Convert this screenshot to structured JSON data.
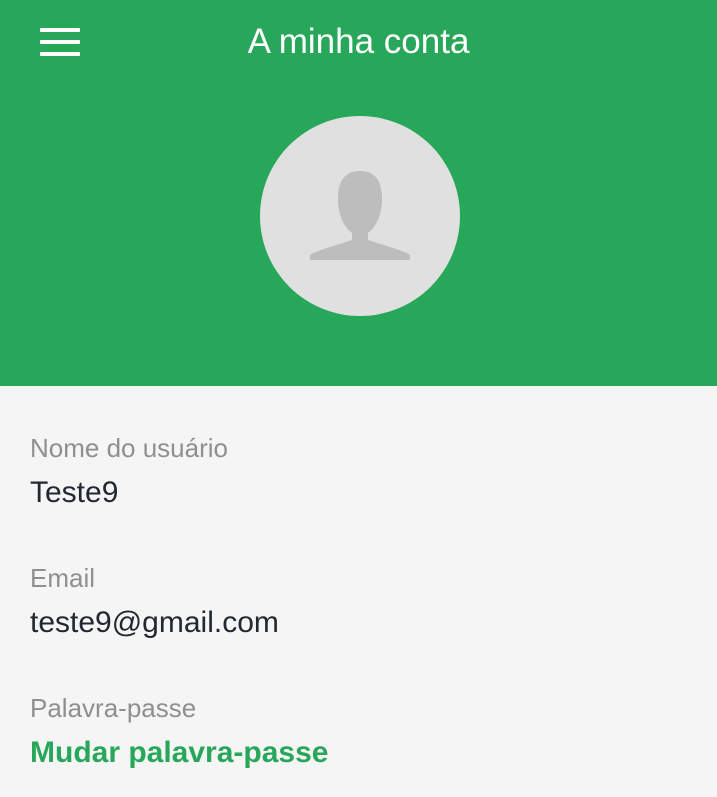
{
  "header": {
    "title": "A minha conta",
    "menu_icon": "hamburger-menu-icon",
    "avatar_icon": "user-placeholder-icon",
    "background_color": "#28a75b"
  },
  "account": {
    "username": {
      "label": "Nome do usuário",
      "value": "Teste9"
    },
    "email": {
      "label": "Email",
      "value": "teste9@gmail.com"
    },
    "password": {
      "label": "Palavra-passe",
      "action_label": "Mudar palavra-passe"
    }
  },
  "colors": {
    "accent": "#28a75b",
    "label_text": "#8f8f8f",
    "value_text": "#222831",
    "page_background": "#f5f5f5"
  }
}
